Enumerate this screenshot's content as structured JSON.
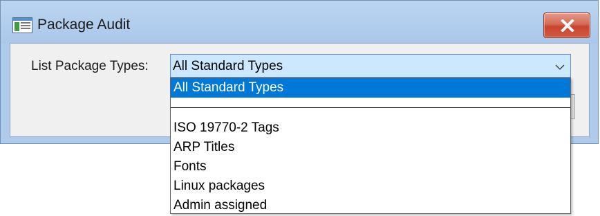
{
  "window": {
    "title": "Package Audit",
    "app_icon": "window-app-icon",
    "close_icon": "close-icon"
  },
  "form": {
    "label": "List Package Types:",
    "selected_value": "All Standard Types",
    "chevron_icon": "chevron-down-icon"
  },
  "dropdown": {
    "selected_option": "All Standard Types",
    "blank_option": "",
    "options": [
      "ISO 19770-2 Tags",
      "ARP Titles",
      "Fonts",
      "Linux packages",
      "Admin assigned"
    ]
  },
  "colors": {
    "selection": "#0078d7",
    "close_button": "#c8452f",
    "title_bar": "#aecbec"
  }
}
